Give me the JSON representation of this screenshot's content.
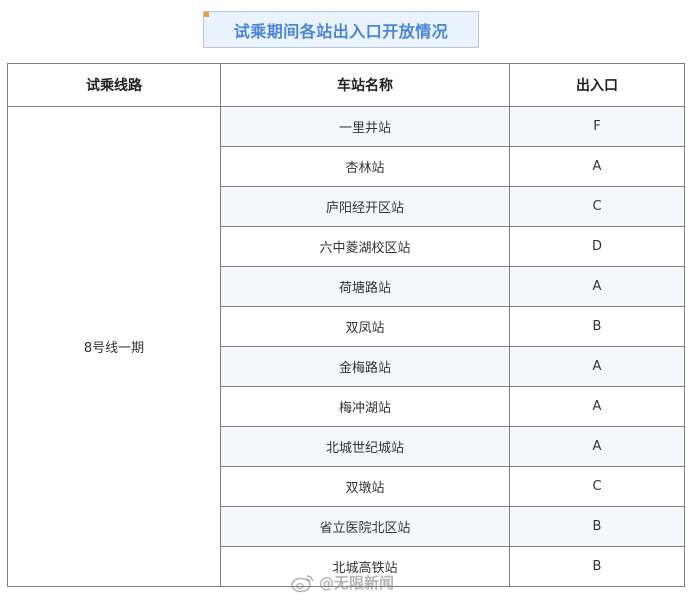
{
  "title": "试乘期间各站出入口开放情况",
  "table": {
    "headers": [
      "试乘线路",
      "车站名称",
      "出入口"
    ],
    "line": "8号线一期",
    "rows": [
      {
        "station": "一里井站",
        "exit": "F"
      },
      {
        "station": "杏林站",
        "exit": "A"
      },
      {
        "station": "庐阳经开区站",
        "exit": "C"
      },
      {
        "station": "六中菱湖校区站",
        "exit": "D"
      },
      {
        "station": "荷塘路站",
        "exit": "A"
      },
      {
        "station": "双凤站",
        "exit": "B"
      },
      {
        "station": "金梅路站",
        "exit": "A"
      },
      {
        "station": "梅冲湖站",
        "exit": "A"
      },
      {
        "station": "北城世纪城站",
        "exit": "A"
      },
      {
        "station": "双墩站",
        "exit": "C"
      },
      {
        "station": "省立医院北区站",
        "exit": "B"
      },
      {
        "station": "北城高铁站",
        "exit": "B"
      }
    ]
  },
  "watermark": {
    "icon": "weibo-icon",
    "text": "@无限新闻"
  }
}
